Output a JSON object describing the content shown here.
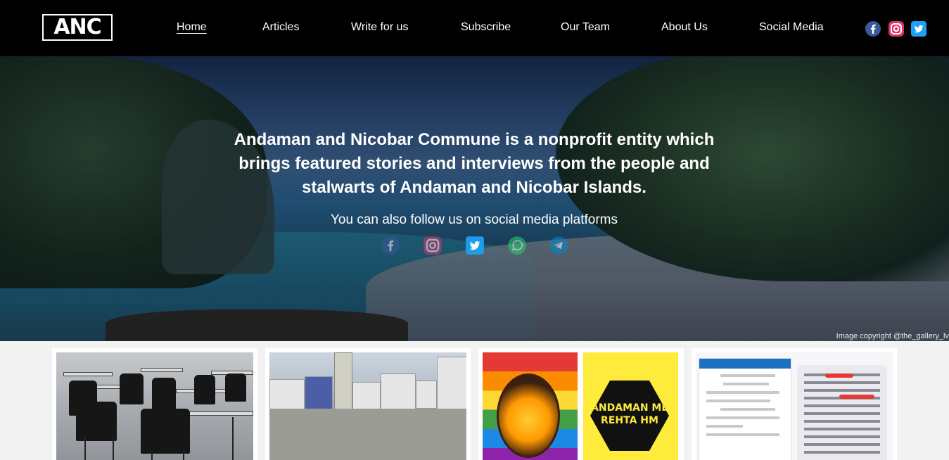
{
  "brand": {
    "logo_text": "ANC"
  },
  "nav": {
    "links": [
      {
        "label": "Home",
        "active": true
      },
      {
        "label": "Articles"
      },
      {
        "label": "Write for us"
      },
      {
        "label": "Subscribe"
      },
      {
        "label": "Our Team"
      },
      {
        "label": "About Us"
      },
      {
        "label": "Social Media"
      }
    ],
    "icons": [
      {
        "name": "facebook-icon",
        "color": "#3b5998"
      },
      {
        "name": "instagram-icon",
        "color": "#e1306c"
      },
      {
        "name": "twitter-icon",
        "color": "#1da1f2"
      }
    ]
  },
  "hero": {
    "title": "Andaman and Nicobar Commune is a nonprofit entity which brings featured stories and interviews from the people and stalwarts of Andaman and Nicobar Islands.",
    "subtitle": "You can also follow us on social media platforms",
    "social_icons": [
      {
        "name": "facebook-icon",
        "color": "#3b5998"
      },
      {
        "name": "instagram-icon",
        "color": "#e1306c"
      },
      {
        "name": "twitter-icon",
        "color": "#1da1f2"
      },
      {
        "name": "whatsapp-icon",
        "color": "#25d366"
      },
      {
        "name": "telegram-icon",
        "color": "#0088cc"
      }
    ],
    "copyright": "Image copyright @the_gallery_lv"
  },
  "cards": [
    {
      "image": "exam-hall-chairs"
    },
    {
      "image": "street-clock-tower"
    },
    {
      "image": "andaman-me-rehta-hm",
      "overlay_text": "ANDAMAN ME REHTA HM"
    },
    {
      "image": "landline-bill-screenshot"
    }
  ]
}
